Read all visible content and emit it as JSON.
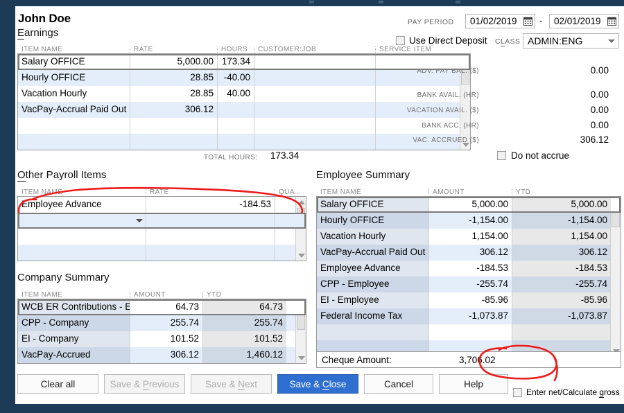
{
  "window": {
    "frame_color": "#1d3a56"
  },
  "header": {
    "employee_name": "John Doe",
    "pay_period_label": "PAY PERIOD",
    "pay_period_start": "01/02/2019",
    "pay_period_end": "02/01/2019",
    "date_separator": "-",
    "use_direct_deposit_label": "Use Direct Deposit",
    "class_label": "CLASS",
    "class_value": "ADMIN:ENG"
  },
  "earnings": {
    "title": "Earnings",
    "title_accel": "E",
    "title_rest": "arnings",
    "columns": [
      "ITEM NAME",
      "RATE",
      "HOURS",
      "CUSTOMER:JOB",
      "SERVICE ITEM"
    ],
    "rows": [
      {
        "item": "Salary OFFICE",
        "rate": "5,000.00",
        "hours": "173.34",
        "customer_job": "",
        "service_item": ""
      },
      {
        "item": "Hourly OFFICE",
        "rate": "28.85",
        "hours": "-40.00",
        "customer_job": "",
        "service_item": ""
      },
      {
        "item": "Vacation Hourly",
        "rate": "28.85",
        "hours": "40.00",
        "customer_job": "",
        "service_item": ""
      },
      {
        "item": "VacPay-Accrual Paid Out",
        "rate": "306.12",
        "hours": "",
        "customer_job": "",
        "service_item": ""
      },
      {
        "item": "",
        "rate": "",
        "hours": "",
        "customer_job": "",
        "service_item": ""
      },
      {
        "item": "",
        "rate": "",
        "hours": "",
        "customer_job": "",
        "service_item": ""
      }
    ],
    "total_hours_label": "TOTAL HOURS:",
    "total_hours_value": "173.34"
  },
  "stats": [
    {
      "label": "ADV. PAY BAL. ($)",
      "value": "0.00"
    },
    {
      "label": "BANK AVAIL. (HR)",
      "value": "0.00"
    },
    {
      "label": "VACATION AVAIL. ($)",
      "value": "0.00"
    },
    {
      "label": "BANK ACC. (HR)",
      "value": "0.00"
    },
    {
      "label": "VAC. ACCRUED ($)",
      "value": "306.12"
    }
  ],
  "do_not_accrue_label": "Do not accrue",
  "other_payroll": {
    "title": "Other Payroll Items",
    "title_accel": "O",
    "title_rest": "ther Payroll Items",
    "columns": [
      "ITEM NAME",
      "RATE",
      "QUA..."
    ],
    "rows": [
      {
        "item": "Employee Advance",
        "rate": "-184.53",
        "qty": ""
      },
      {
        "item": "",
        "rate": "",
        "qty": ""
      },
      {
        "item": "",
        "rate": "",
        "qty": ""
      },
      {
        "item": "",
        "rate": "",
        "qty": ""
      }
    ]
  },
  "company_summary": {
    "title": "Company Summary",
    "columns": [
      "ITEM NAME",
      "AMOUNT",
      "YTD"
    ],
    "rows": [
      {
        "item": "WCB ER Contributions - E...",
        "amount": "64.73",
        "ytd": "64.73"
      },
      {
        "item": "CPP - Company",
        "amount": "255.74",
        "ytd": "255.74"
      },
      {
        "item": "EI - Company",
        "amount": "101.52",
        "ytd": "101.52"
      },
      {
        "item": "VacPay-Accrued",
        "amount": "306.12",
        "ytd": "1,460.12"
      }
    ]
  },
  "employee_summary": {
    "title": "Employee Summary",
    "columns": [
      "ITEM NAME",
      "AMOUNT",
      "YTD"
    ],
    "rows": [
      {
        "item": "Salary OFFICE",
        "amount": "5,000.00",
        "ytd": "5,000.00"
      },
      {
        "item": "Hourly OFFICE",
        "amount": "-1,154.00",
        "ytd": "-1,154.00"
      },
      {
        "item": "Vacation Hourly",
        "amount": "1,154.00",
        "ytd": "1,154.00"
      },
      {
        "item": "VacPay-Accrual Paid Out",
        "amount": "306.12",
        "ytd": "306.12"
      },
      {
        "item": "Employee Advance",
        "amount": "-184.53",
        "ytd": "-184.53"
      },
      {
        "item": "CPP - Employee",
        "amount": "-255.74",
        "ytd": "-255.74"
      },
      {
        "item": "EI - Employee",
        "amount": "-85.96",
        "ytd": "-85.96"
      },
      {
        "item": "Federal Income Tax",
        "amount": "-1,073.87",
        "ytd": "-1,073.87"
      },
      {
        "item": "",
        "amount": "",
        "ytd": ""
      },
      {
        "item": "",
        "amount": "",
        "ytd": ""
      }
    ],
    "cheque_amount_label": "Cheque Amount:",
    "cheque_amount_value": "3,706.02"
  },
  "footer": {
    "clear_all": "Clear all",
    "save_previous_accel": "Save & ",
    "save_previous_u": "P",
    "save_previous_rest": "revious",
    "save_next_accel": "Save & ",
    "save_next_u": "N",
    "save_next_rest": "ext",
    "save_close_accel": "Save & ",
    "save_close_u": "C",
    "save_close_rest": "lose",
    "cancel": "Cancel",
    "help": "Help",
    "enter_net_pre": "Enter net/Calculate ",
    "enter_net_u": "g",
    "enter_net_post": "ross"
  },
  "annotations": {
    "accent_color": "#ee1b1b",
    "circled_items": [
      "other-payroll-employee-advance-row",
      "cheque-amount-value"
    ]
  }
}
